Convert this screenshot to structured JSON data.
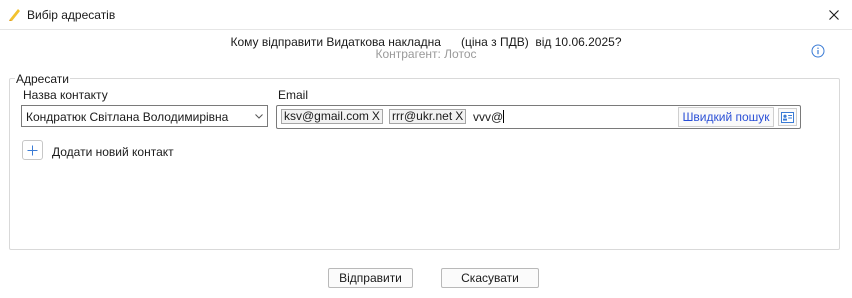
{
  "window": {
    "title": "Вибір адресатів",
    "icon": "pencil-icon",
    "close_icon": "close-icon"
  },
  "header": {
    "line1": "Кому відправити Видаткова накладна      (ціна з ПДВ)  від 10.06.2025?",
    "line2": "Контрагент: Лотос",
    "info_icon": "info-icon"
  },
  "recipients": {
    "group_label": "Адресати",
    "contact_label": "Назва контакту",
    "email_label": "Email",
    "contact_value": "Кондратюк Світлана Володимирівна",
    "emails": [
      {
        "address": "ksv@gmail.com",
        "remove": "X"
      },
      {
        "address": "rrr@ukr.net",
        "remove": "X"
      }
    ],
    "typed_text": "vvv@",
    "quick_search_label": "Швидкий пошук",
    "add_contact_label": "Додати новий контакт"
  },
  "footer": {
    "send_label": "Відправити",
    "cancel_label": "Скасувати"
  },
  "colors": {
    "link_blue": "#2a4fd6",
    "info_blue": "#3a7bd5",
    "border": "#7a7a7a"
  }
}
